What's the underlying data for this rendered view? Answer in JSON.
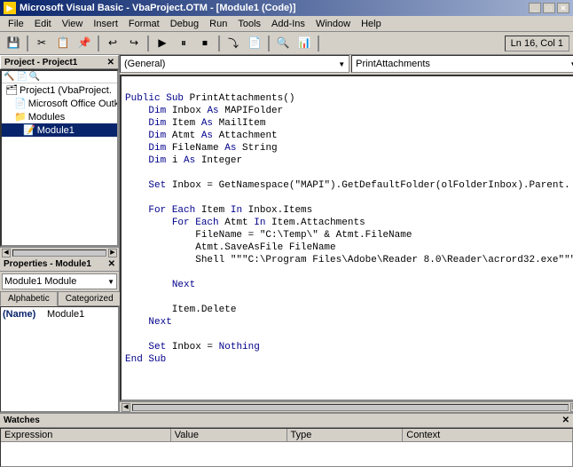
{
  "titlebar": {
    "title": "Microsoft Visual Basic - VbaProject.OTM - [Module1 (Code)]",
    "icon": "VB",
    "minimize": "_",
    "restore": "□",
    "close": "✕"
  },
  "menubar": {
    "items": [
      "File",
      "Edit",
      "View",
      "Insert",
      "Format",
      "Debug",
      "Run",
      "Tools",
      "Add-Ins",
      "Window",
      "Help"
    ]
  },
  "toolbar": {
    "status": "Ln 16, Col 1"
  },
  "project_panel": {
    "title": "Project - Project1",
    "tree": [
      {
        "label": "Project1 (VbaProject.",
        "indent": 0,
        "icon": "📁",
        "selected": false
      },
      {
        "label": "Microsoft Office Outk",
        "indent": 1,
        "icon": "📄",
        "selected": false
      },
      {
        "label": "Modules",
        "indent": 1,
        "icon": "📁",
        "selected": false
      },
      {
        "label": "Module1",
        "indent": 2,
        "icon": "📝",
        "selected": true
      }
    ]
  },
  "properties_panel": {
    "title": "Properties - Module1",
    "dropdown_value": "Module1  Module",
    "tabs": [
      "Alphabetic",
      "Categorized"
    ],
    "active_tab": "Alphabetic",
    "rows": [
      {
        "label": "(Name)",
        "value": "Module1"
      }
    ]
  },
  "code_panel": {
    "left_dropdown": "(General)",
    "right_dropdown": "PrintAttachments",
    "lines": [
      "",
      "Public Sub PrintAttachments()",
      "    Dim Inbox As MAPIFolder",
      "    Dim Item As MailItem",
      "    Dim Atmt As Attachment",
      "    Dim FileName As String",
      "    Dim i As Integer",
      "",
      "    Set Inbox = GetNamespace(\"MAPI\").GetDefaultFolder(olFolderInbox).Parent.",
      "",
      "    For Each Item In Inbox.Items",
      "        For Each Atmt In Item.Attachments",
      "            FileName = \"C:\\Temp\\\" & Atmt.FileName",
      "            Atmt.SaveAsFile FileName",
      "            Shell \"\"\"C:\\Program Files\\Adobe\\Reader 8.0\\Reader\\acrord32.exe\"\"\"",
      "",
      "        Next",
      "",
      "        Item.Delete",
      "    Next",
      "",
      "    Set Inbox = Nothing",
      "End Sub",
      ""
    ],
    "keywords": [
      "Public",
      "Sub",
      "End",
      "Dim",
      "As",
      "Set",
      "For",
      "Each",
      "In",
      "Next"
    ],
    "types": [
      "MAPIFolder",
      "MailItem",
      "Attachment",
      "String",
      "Integer"
    ]
  },
  "watches_panel": {
    "title": "Watches",
    "columns": [
      "Expression",
      "Value",
      "Type",
      "Context"
    ]
  }
}
